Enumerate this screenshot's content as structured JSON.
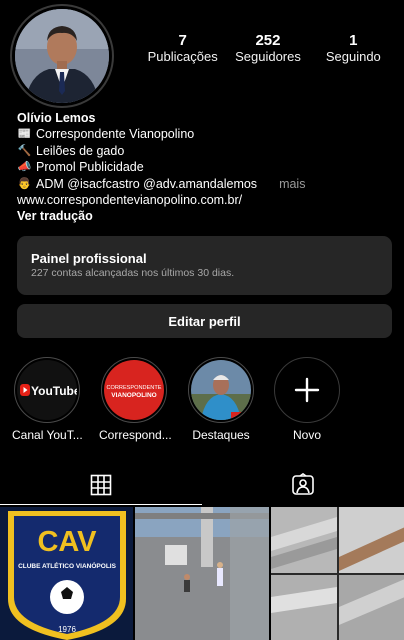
{
  "profile": {
    "stats": [
      {
        "value": "7",
        "label": "Publicações"
      },
      {
        "value": "252",
        "label": "Seguidores"
      },
      {
        "value": "1",
        "label": "Seguindo"
      }
    ],
    "name": "Olívio Lemos",
    "bio_lines": [
      {
        "icon": "newspaper-icon",
        "text": "Correspondente Vianopolino"
      },
      {
        "icon": "hammer-icon",
        "text": "Leilões de gado"
      },
      {
        "icon": "megaphone-icon",
        "text": "Promol Publicidade"
      },
      {
        "icon": "person-icon",
        "text": "ADM @isacfcastro @adv.amandalemos"
      }
    ],
    "more_label": "mais",
    "website": "www.correspondentevianopolino.com.br/",
    "translate_label": "Ver tradução"
  },
  "panel": {
    "title": "Painel profissional",
    "subtitle": "227 contas alcançadas nos últimos 30 dias."
  },
  "edit_label": "Editar perfil",
  "highlights": [
    {
      "label": "Canal YouT...",
      "badge": "YouTube"
    },
    {
      "label": "Correspond...",
      "badge_line1": "CORRESPONDENTE",
      "badge_line2": "VIANOPOLINO"
    },
    {
      "label": "Destaques"
    },
    {
      "label": "Novo"
    }
  ],
  "posts": {
    "club_initials": "CAV",
    "club_name": "CLUBE ATLÉTICO VIANÓPOLIS",
    "club_year": "1976"
  },
  "colors": {
    "background": "#000000",
    "panel": "#262626",
    "youtube_red": "#e62117"
  }
}
